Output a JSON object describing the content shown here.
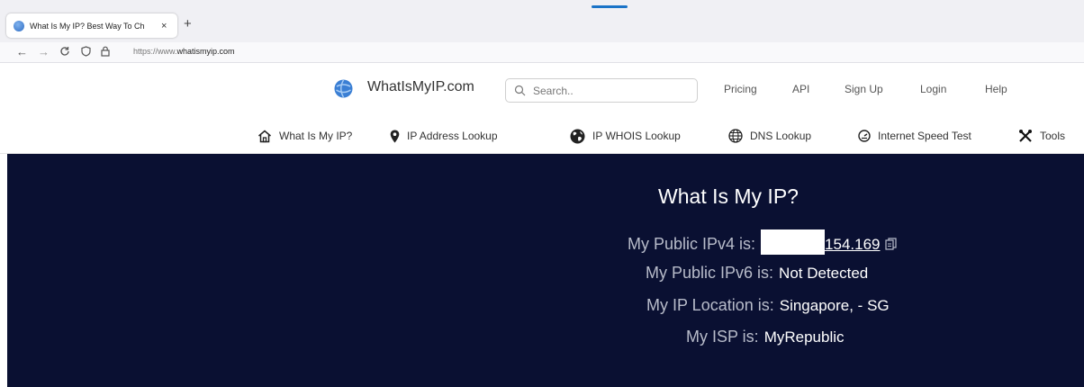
{
  "browser": {
    "tab": {
      "title": "What Is My IP? Best Way To Ch",
      "close": "×"
    },
    "new_tab": "+",
    "url": {
      "prefix": "https://www.",
      "host": "whatismyip.com"
    }
  },
  "header": {
    "logo": "WhatIsMyIP.com",
    "search_placeholder": "Search..",
    "links": [
      "Pricing",
      "API",
      "Sign Up",
      "Login",
      "Help"
    ]
  },
  "menu": [
    {
      "label": "What Is My IP?",
      "icon": "home-icon"
    },
    {
      "label": "IP Address Lookup",
      "icon": "location-pin-icon"
    },
    {
      "label": "IP WHOIS Lookup",
      "icon": "globe-icon"
    },
    {
      "label": "DNS Lookup",
      "icon": "www-globe-icon"
    },
    {
      "label": "Internet Speed Test",
      "icon": "speedometer-icon"
    },
    {
      "label": "Tools",
      "icon": "tools-icon"
    }
  ],
  "hero": {
    "title": "What Is My IP?",
    "ipv4": {
      "label": "My Public IPv4 is:",
      "value_visible": "154.169"
    },
    "ipv6": {
      "label": "My Public IPv6 is:",
      "value": "Not Detected"
    },
    "location": {
      "label": "My IP Location is:",
      "value": "Singapore, - SG"
    },
    "isp": {
      "label": "My ISP is:",
      "value": "MyRepublic"
    }
  },
  "colors": {
    "hero_bg": "#0a1032",
    "accent": "#1a73c7"
  }
}
